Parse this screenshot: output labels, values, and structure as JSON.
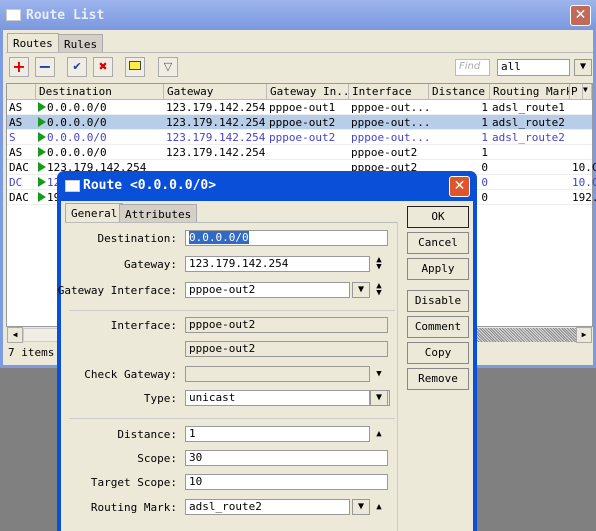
{
  "main": {
    "title": "Route List",
    "tabs": [
      "Routes",
      "Rules"
    ],
    "toolbar": {
      "find_placeholder": "Find",
      "filter_value": "all"
    },
    "columns": [
      "Destination",
      "Gateway",
      "Gateway In...",
      "Interface",
      "Distance",
      "Routing Mark",
      "P"
    ],
    "rows": [
      {
        "flags": "AS",
        "dest": "0.0.0.0/0",
        "gw": "123.179.142.254",
        "gwi": "pppoe-out1",
        "iface": "pppoe-out...",
        "dist": "1",
        "mark": "adsl_route1",
        "p": "",
        "sel": false,
        "blue": false
      },
      {
        "flags": "AS",
        "dest": "0.0.0.0/0",
        "gw": "123.179.142.254",
        "gwi": "pppoe-out2",
        "iface": "pppoe-out...",
        "dist": "1",
        "mark": "adsl_route2",
        "p": "",
        "sel": true,
        "blue": false
      },
      {
        "flags": "S",
        "dest": "0.0.0.0/0",
        "gw": "123.179.142.254",
        "gwi": "pppoe-out2",
        "iface": "pppoe-out...",
        "dist": "1",
        "mark": "adsl_route2",
        "p": "",
        "sel": false,
        "blue": true
      },
      {
        "flags": "AS",
        "dest": "0.0.0.0/0",
        "gw": "123.179.142.254",
        "gwi": "",
        "iface": "pppoe-out2",
        "dist": "1",
        "mark": "",
        "p": "",
        "sel": false,
        "blue": false
      },
      {
        "flags": "DAC",
        "dest": "123.179.142.254",
        "gw": "",
        "gwi": "",
        "iface": "pppoe-out2",
        "dist": "0",
        "mark": "",
        "p": "10.C",
        "sel": false,
        "blue": false
      },
      {
        "flags": "DC",
        "dest": "12",
        "gw": "",
        "gwi": "",
        "iface": "",
        "dist": "0",
        "mark": "",
        "p": "10.C",
        "sel": false,
        "blue": true
      },
      {
        "flags": "DAC",
        "dest": "19",
        "gw": "",
        "gwi": "",
        "iface": "",
        "dist": "0",
        "mark": "",
        "p": "192.",
        "sel": false,
        "blue": false
      }
    ],
    "status": "7 items"
  },
  "dialog": {
    "title": "Route <0.0.0.0/0>",
    "tabs": [
      "General",
      "Attributes"
    ],
    "fields": {
      "destination_label": "Destination:",
      "destination": "0.0.0.0/0",
      "gateway_label": "Gateway:",
      "gateway": "123.179.142.254",
      "gwi_label": "Gateway Interface:",
      "gwi": "pppoe-out2",
      "iface_label": "Interface:",
      "iface1": "pppoe-out2",
      "iface2": "pppoe-out2",
      "check_label": "Check Gateway:",
      "check": "",
      "type_label": "Type:",
      "type": "unicast",
      "distance_label": "Distance:",
      "distance": "1",
      "scope_label": "Scope:",
      "scope": "30",
      "tscope_label": "Target Scope:",
      "tscope": "10",
      "mark_label": "Routing Mark:",
      "mark": "adsl_route2"
    },
    "buttons": [
      "OK",
      "Cancel",
      "Apply",
      "Disable",
      "Comment",
      "Copy",
      "Remove"
    ]
  },
  "colors": {
    "selected_row": "#b8cde8",
    "disabled_text": "#4444cc",
    "flag": "#1a9a1a",
    "active_title": "#0a4fd8"
  }
}
